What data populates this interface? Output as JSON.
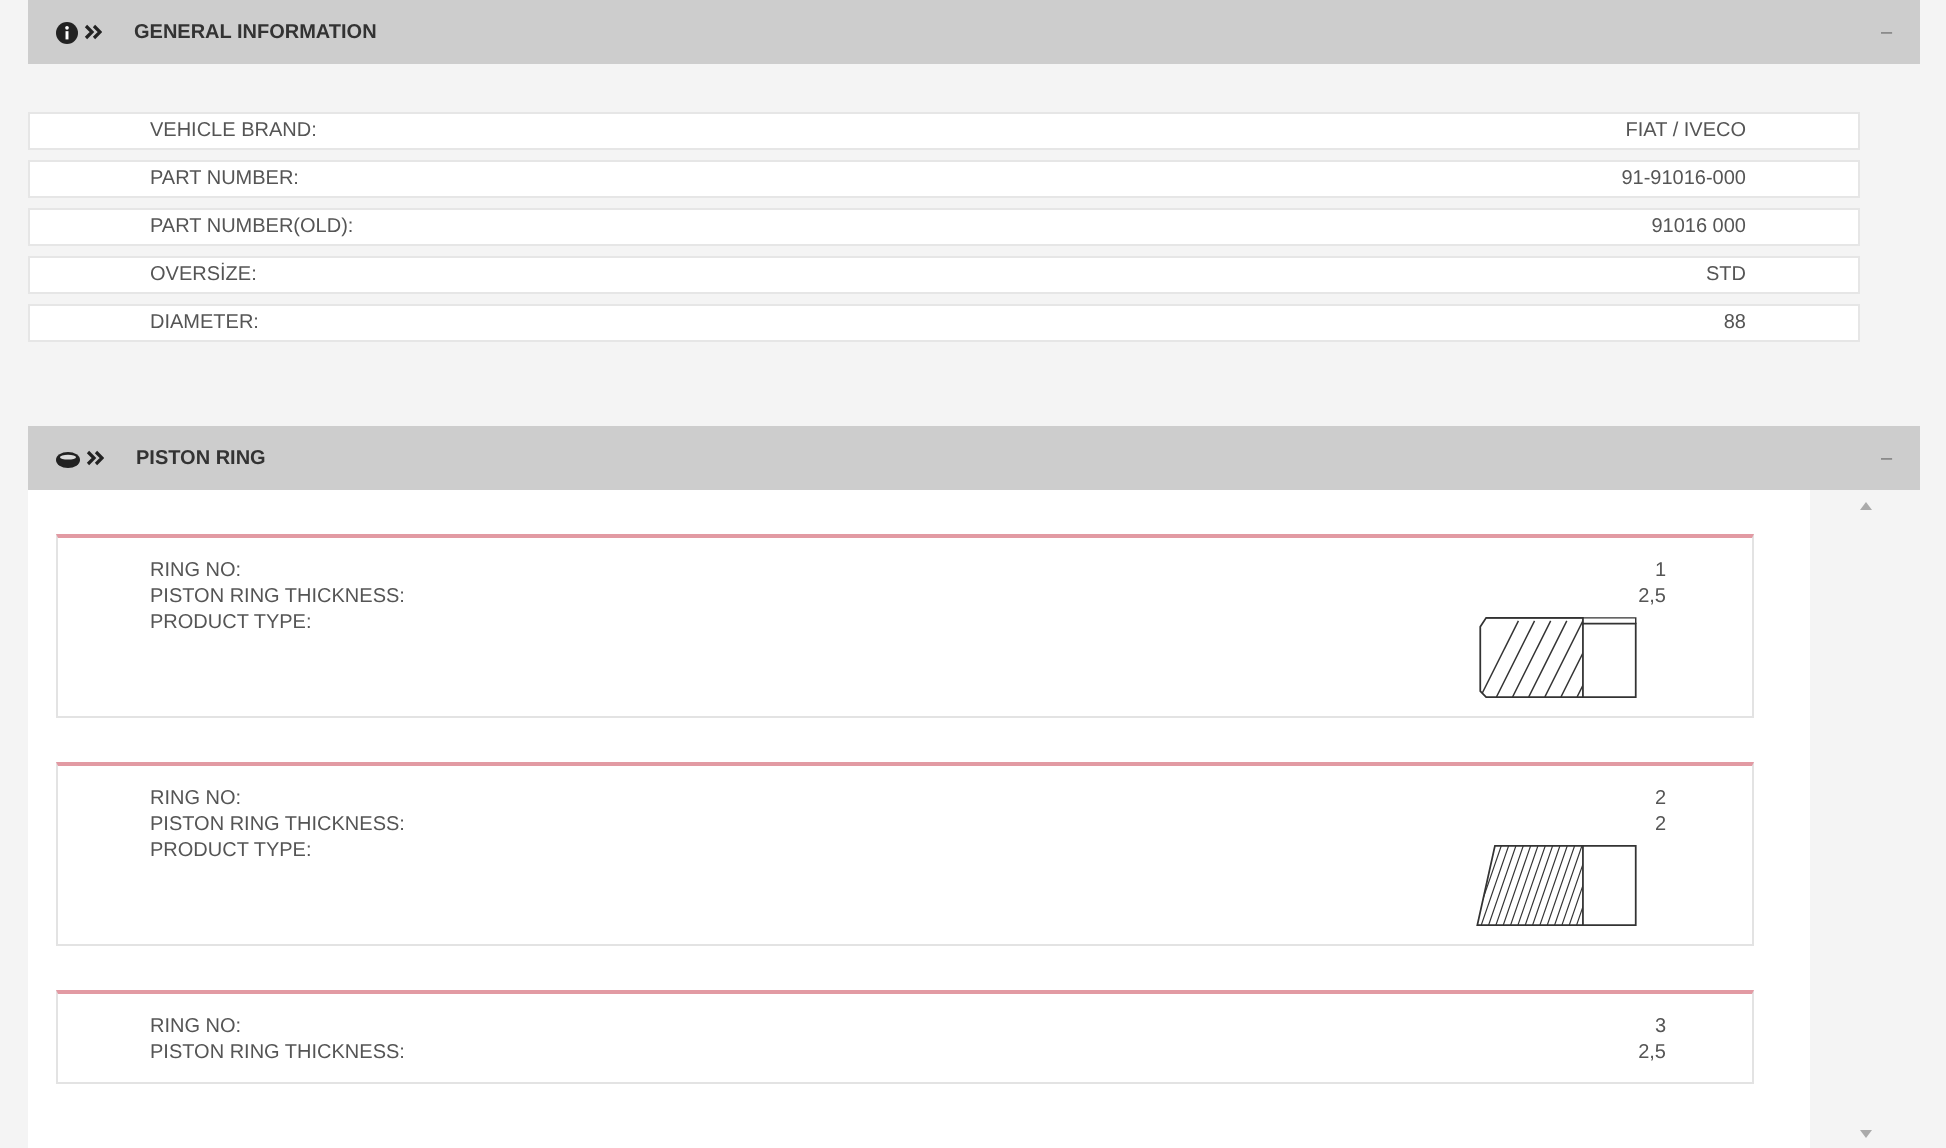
{
  "general": {
    "title": "GENERAL INFORMATION",
    "collapse": "–",
    "rows": [
      {
        "label": "VEHICLE BRAND:",
        "value": "FIAT / IVECO"
      },
      {
        "label": "PART NUMBER:",
        "value": "91-91016-000"
      },
      {
        "label": "PART NUMBER(OLD):",
        "value": "91016 000"
      },
      {
        "label": "OVERSİZE:",
        "value": "STD"
      },
      {
        "label": "DIAMETER:",
        "value": "88"
      }
    ]
  },
  "piston_ring": {
    "title": "PISTON RING",
    "collapse": "–",
    "rings": [
      {
        "kind": "chamfered",
        "ring_no_label": "RING NO:",
        "ring_no": "1",
        "thickness_label": "PISTON RING THICKNESS:",
        "thickness": "2,5",
        "product_type_label": "PRODUCT TYPE:"
      },
      {
        "kind": "tapered",
        "ring_no_label": "RING NO:",
        "ring_no": "2",
        "thickness_label": "PISTON RING THICKNESS:",
        "thickness": "2",
        "product_type_label": "PRODUCT TYPE:"
      },
      {
        "kind": "plain",
        "ring_no_label": "RING NO:",
        "ring_no": "3",
        "thickness_label": "PISTON RING THICKNESS:",
        "thickness": "2,5"
      }
    ]
  }
}
